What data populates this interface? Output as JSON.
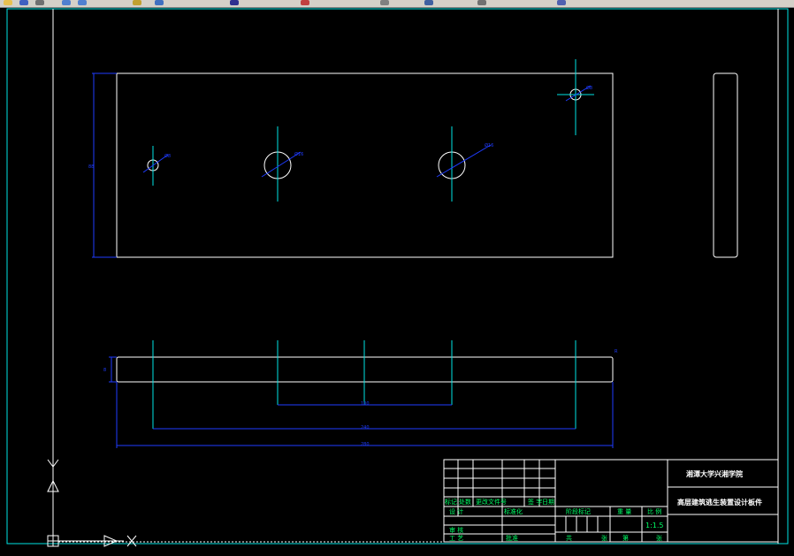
{
  "window": {
    "app": "AutoCAD drawing editor"
  },
  "toolbar": {
    "icons": [
      "open-icon",
      "save-icon",
      "print-icon",
      "undo-icon",
      "redo-icon",
      "pan-icon",
      "zoom-icon",
      "properties-icon",
      "layer-icon",
      "match-icon",
      "text-style-icon",
      "dim-style-icon",
      "block-icon"
    ]
  },
  "colors": {
    "background": "#000000",
    "geometry": "#ffffff",
    "centerline": "#00e5e5",
    "dimension": "#1f3cff",
    "frame": "#00e5e5",
    "title_text": "#00ff66"
  },
  "title_block": {
    "school": "湘潭大学兴湘学院",
    "drawing_name": "高层建筑逃生装置设计板件",
    "scale_value": "1:1.5",
    "headers": {
      "mark": "标记",
      "count": "处数",
      "zone": "分区",
      "change_doc": "更改文件号",
      "sign": "签 字",
      "date": "日期",
      "design": "设 计",
      "standardize": "标准化",
      "stage_mark": "阶段标记",
      "weight": "重 量",
      "scale": "比 例",
      "review": "审 核",
      "process": "工 艺",
      "approve": "批准",
      "sheets_total": "共",
      "sheet": "张",
      "sheet_no": "第",
      "sheet_unit": "张"
    }
  },
  "dimensions": {
    "top_view_height": "88",
    "hole_small_left": "Ø8",
    "hole_large_1": "Ø16",
    "hole_large_2": "Ø16",
    "hole_small_right": "Ø8",
    "bottom_thickness": "8",
    "span_inner": "100",
    "span_holes": "240",
    "overall_length": "280",
    "right_edge": "R"
  }
}
